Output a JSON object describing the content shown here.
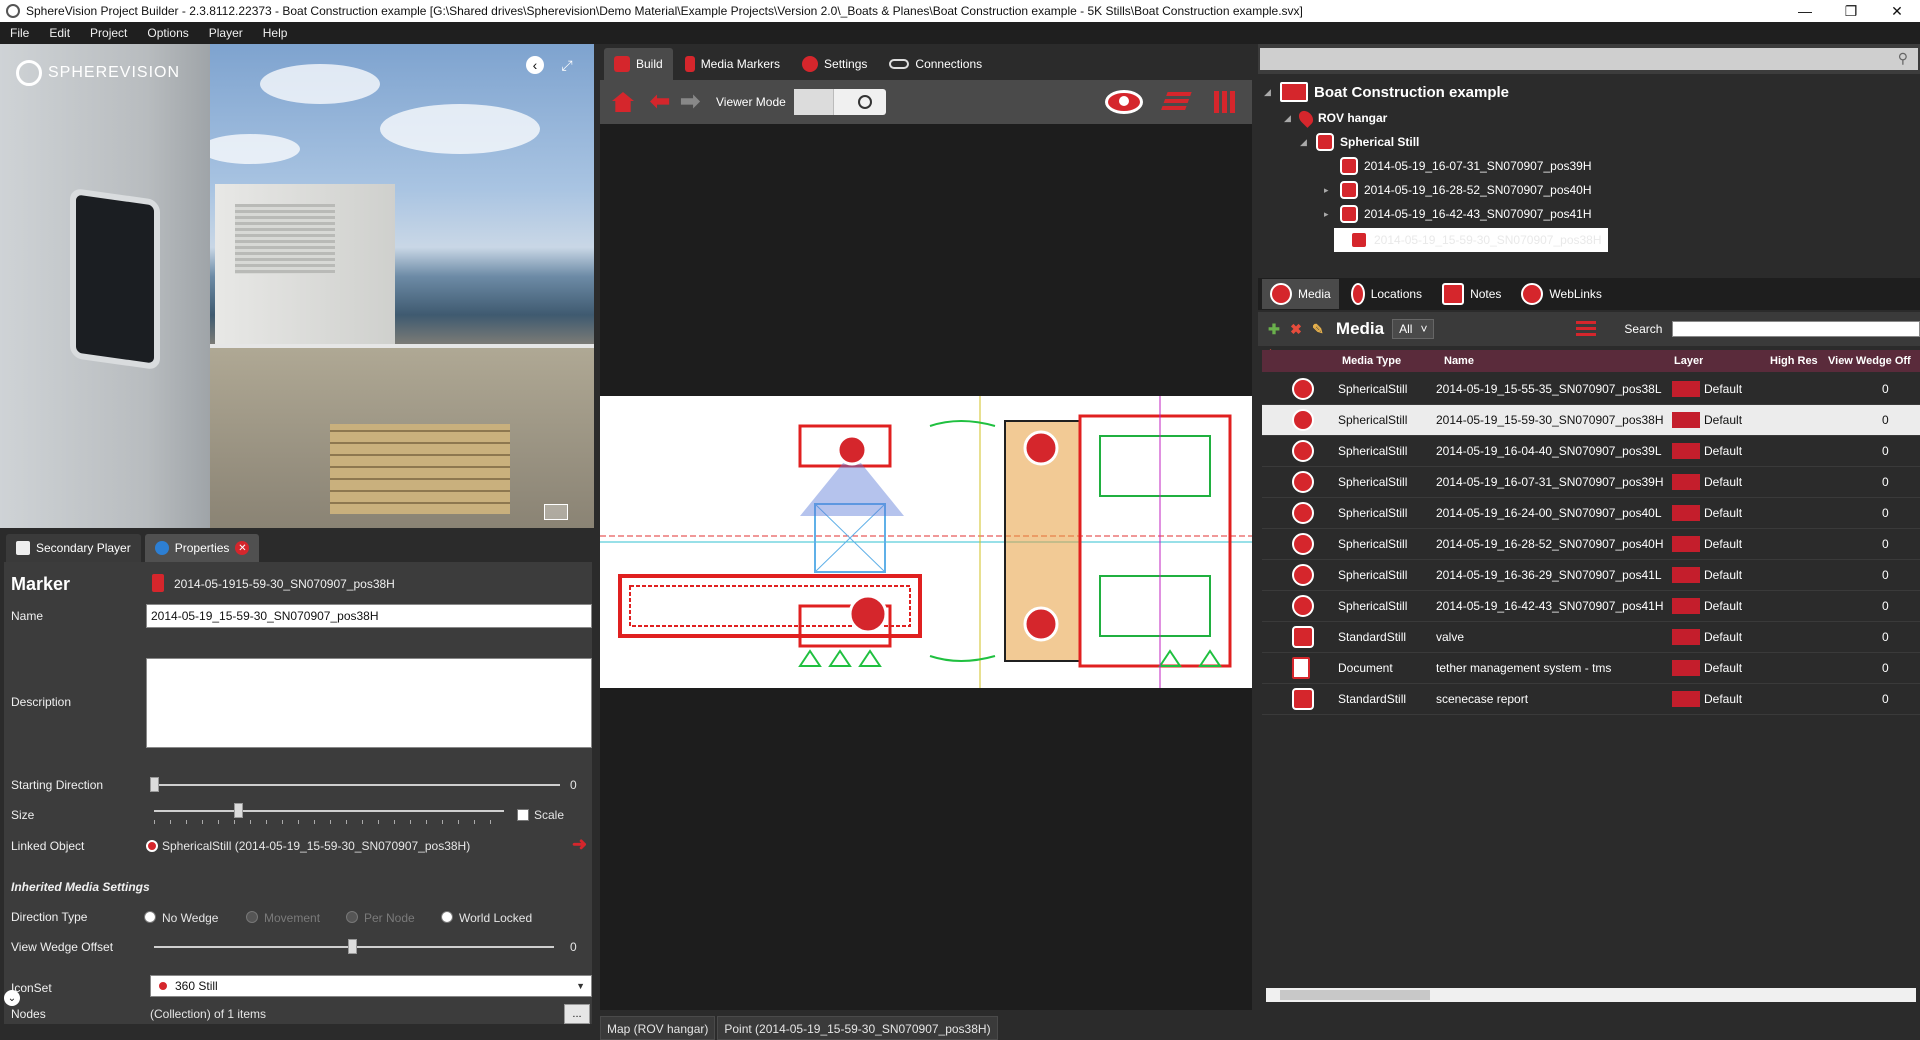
{
  "window": {
    "title": "SphereVision Project Builder - 2.3.8112.22373 - Boat Construction example [G:\\Shared drives\\Spherevision\\Demo Material\\Example Projects\\Version 2.0\\_Boats & Planes\\Boat Construction example - 5K Stills\\Boat Construction example.svx]",
    "minimize": "—",
    "restore": "❐",
    "close": "✕"
  },
  "menu": [
    "File",
    "Edit",
    "Project",
    "Options",
    "Player",
    "Help"
  ],
  "player": {
    "logo": "SPHEREVISION",
    "back_glyph": "‹",
    "expand_glyph": "⤢"
  },
  "left_tabs": {
    "secondary_player": "Secondary Player",
    "properties": "Properties",
    "close_glyph": "✕"
  },
  "properties": {
    "title": "Marker",
    "marker_value": "2014-05-1915-59-30_SN070907_pos38H",
    "name_label": "Name",
    "name_value": "2014-05-19_15-59-30_SN070907_pos38H",
    "description_label": "Description",
    "starting_direction_label": "Starting Direction",
    "starting_direction_value": "0",
    "size_label": "Size",
    "scale_label": "Scale",
    "linked_object_label": "Linked Object",
    "linked_object_value": "SphericalStill (2014-05-19_15-59-30_SN070907_pos38H)",
    "linked_arrow": "➜",
    "inherited_section": "Inherited Media Settings",
    "direction_type_label": "Direction Type",
    "direction_options": [
      "No Wedge",
      "Movement",
      "Per Node",
      "World Locked"
    ],
    "view_wedge_offset_label": "View Wedge Offset",
    "view_wedge_offset_value": "0",
    "iconset_label": "IconSet",
    "iconset_value": "360 Still",
    "nodes_label": "Nodes",
    "nodes_value": "(Collection) of 1 items",
    "nodes_button": "...",
    "collapse_glyph": "⌄"
  },
  "middle_tabs": [
    "Build",
    "Media Markers",
    "Settings",
    "Connections"
  ],
  "map_toolbar": {
    "back_glyph": "⬅",
    "fwd_glyph": "➡",
    "viewer_mode_label": "Viewer Mode"
  },
  "status": {
    "map": "Map (ROV hangar)",
    "point": "Point (2014-05-19_15-59-30_SN070907_pos38H)"
  },
  "tree": {
    "root": "Boat Construction example",
    "location": "ROV hangar",
    "group": "Spherical Still",
    "items": [
      "2014-05-19_16-07-31_SN070907_pos39H",
      "2014-05-19_16-28-52_SN070907_pos40H",
      "2014-05-19_16-42-43_SN070907_pos41H",
      "2014-05-19_15-59-30_SN070907_pos38H"
    ]
  },
  "right_tabs": [
    "Media",
    "Locations",
    "Notes",
    "WebLinks"
  ],
  "media_toolbar": {
    "add": "✚",
    "delete": "✖",
    "tree": "⇶",
    "edit": "✎",
    "title": "Media",
    "filter": "All",
    "filter_arrow": "˅",
    "search_label": "Search"
  },
  "grid": {
    "columns": [
      "Media Type",
      "Name",
      "Layer",
      "High Res",
      "View Wedge Off"
    ],
    "rows": [
      {
        "type": "SphericalStill",
        "name": "2014-05-19_15-55-35_SN070907_pos38L",
        "layer": "Default",
        "wedge": "0",
        "icon": "camera"
      },
      {
        "type": "SphericalStill",
        "name": "2014-05-19_15-59-30_SN070907_pos38H",
        "layer": "Default",
        "wedge": "0",
        "icon": "camera"
      },
      {
        "type": "SphericalStill",
        "name": "2014-05-19_16-04-40_SN070907_pos39L",
        "layer": "Default",
        "wedge": "0",
        "icon": "camera"
      },
      {
        "type": "SphericalStill",
        "name": "2014-05-19_16-07-31_SN070907_pos39H",
        "layer": "Default",
        "wedge": "0",
        "icon": "camera"
      },
      {
        "type": "SphericalStill",
        "name": "2014-05-19_16-24-00_SN070907_pos40L",
        "layer": "Default",
        "wedge": "0",
        "icon": "camera"
      },
      {
        "type": "SphericalStill",
        "name": "2014-05-19_16-28-52_SN070907_pos40H",
        "layer": "Default",
        "wedge": "0",
        "icon": "camera"
      },
      {
        "type": "SphericalStill",
        "name": "2014-05-19_16-36-29_SN070907_pos41L",
        "layer": "Default",
        "wedge": "0",
        "icon": "camera"
      },
      {
        "type": "SphericalStill",
        "name": "2014-05-19_16-42-43_SN070907_pos41H",
        "layer": "Default",
        "wedge": "0",
        "icon": "camera"
      },
      {
        "type": "StandardStill",
        "name": "valve",
        "layer": "Default",
        "wedge": "0",
        "icon": "standard"
      },
      {
        "type": "Document",
        "name": "tether management system - tms",
        "layer": "Default",
        "wedge": "0",
        "icon": "document"
      },
      {
        "type": "StandardStill",
        "name": "scenecase report",
        "layer": "Default",
        "wedge": "0",
        "icon": "standard"
      }
    ]
  },
  "colors": {
    "accent_red": "#d5262c",
    "grid_header": "#5a2b3b",
    "panel_dark": "#2b2b2b"
  }
}
